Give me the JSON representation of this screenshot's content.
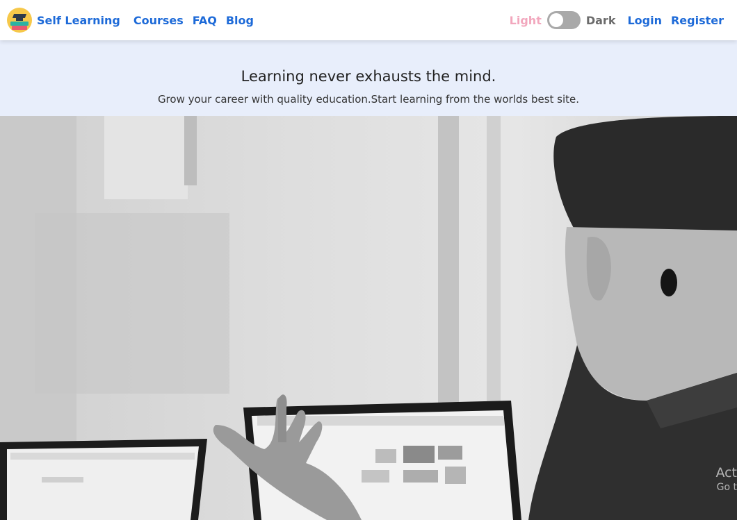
{
  "nav": {
    "brand": "Self Learning",
    "links": [
      "Courses",
      "FAQ",
      "Blog"
    ],
    "theme_light": "Light",
    "theme_dark": "Dark",
    "login": "Login",
    "register": "Register"
  },
  "hero": {
    "title": "Learning never exhausts the mind.",
    "subtitle": "Grow your career with quality education.Start learning from the worlds best site."
  },
  "watermark": {
    "line1": "Act",
    "line2": "Go t"
  },
  "colors": {
    "link": "#1d6ad8",
    "hero_bg": "#e8eefb",
    "light_label": "#f2a7bd"
  }
}
